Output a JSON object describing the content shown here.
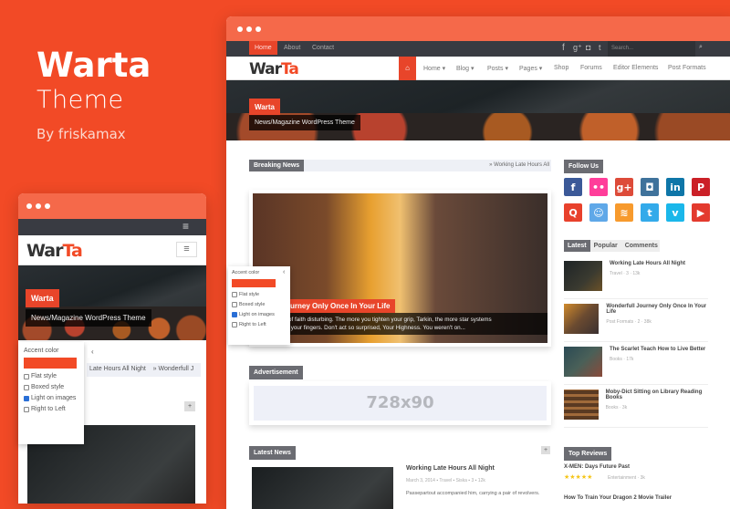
{
  "brand": {
    "title": "Warta",
    "subtitle": "Theme",
    "author": "By friskamax",
    "accent": "#f24a26"
  },
  "desktop": {
    "topbar": {
      "links": [
        "Home",
        "About",
        "Contact"
      ],
      "social_icons": [
        "facebook-icon",
        "google-plus-icon",
        "instagram-icon",
        "twitter-icon"
      ],
      "search_placeholder": "Search..."
    },
    "logo": {
      "part1": "War",
      "part2": "Ta"
    },
    "nav": [
      "Home ▾",
      "Blog ▾",
      "Posts ▾",
      "Pages ▾",
      "Shop",
      "Forums",
      "Editor Elements",
      "Post Formats"
    ],
    "hero": {
      "tag": "Warta",
      "tagline": "News/Magazine WordPress Theme"
    },
    "breaking": {
      "label": "Breaking News",
      "item": "» Working Late Hours All"
    },
    "featured": {
      "title": "derfull Journey Only Once In Your Life",
      "excerpt1": "your lack of faith disturbing. The more you tighten your grip, Tarkin, the more star systems",
      "excerpt2": "ip through your fingers. Don't act so surprised, Your Highness. You weren't on..."
    },
    "ad": {
      "label": "Advertisement",
      "size": "728x90"
    },
    "latest": {
      "label": "Latest News",
      "plus": "+",
      "title": "Working Late Hours All Night",
      "meta": "March 3, 2014  ▪ Travel  ▪ Siska  ▪ 3  ▪ 12k",
      "excerpt": "Passepartout accompanied him, carrying a pair of revolvers."
    },
    "sidebar": {
      "follow_label": "Follow Us",
      "social": [
        {
          "name": "facebook",
          "glyph": "f",
          "color": "#3b5998"
        },
        {
          "name": "flickr",
          "glyph": "••",
          "color": "#ff3d9a"
        },
        {
          "name": "google-plus",
          "glyph": "g+",
          "color": "#dd4b39"
        },
        {
          "name": "instagram",
          "glyph": "◘",
          "color": "#3f729b"
        },
        {
          "name": "linkedin",
          "glyph": "in",
          "color": "#0e76a8"
        },
        {
          "name": "pinterest",
          "glyph": "P",
          "color": "#cb2027"
        },
        {
          "name": "quora",
          "glyph": "Q",
          "color": "#e8412c"
        },
        {
          "name": "reddit",
          "glyph": "☺",
          "color": "#5fa8e8"
        },
        {
          "name": "rss",
          "glyph": "≋",
          "color": "#f79a2d"
        },
        {
          "name": "twitter",
          "glyph": "t",
          "color": "#33aaea"
        },
        {
          "name": "vimeo",
          "glyph": "v",
          "color": "#1ab7ea"
        },
        {
          "name": "youtube",
          "glyph": "▶",
          "color": "#e33a2e"
        }
      ],
      "tabs": [
        "Latest",
        "Popular",
        "Comments"
      ],
      "posts": [
        {
          "title": "Working Late Hours All Night",
          "meta": "Travel  · 3  · 13k",
          "thumb": "linear-gradient(135deg,#1e2426,#3a3a30 60%,#6b5128)"
        },
        {
          "title": "Wonderfull Journey Only Once In Your Life",
          "meta": "Post Formats  · 2  · 38k",
          "thumb": "linear-gradient(135deg,#d08a2c,#6a4a30 50%,#3a3030)"
        },
        {
          "title": "The Scarlet Teach How to Live Better",
          "meta": "Books  · 17k",
          "thumb": "linear-gradient(135deg,#2a4a55,#4a6058 50%,#8a4a3a)"
        },
        {
          "title": "Moby-Dict Sitting on Library Reading Books",
          "meta": "Books  · 3k",
          "thumb": "repeating-linear-gradient(0deg,#5a3a22 0 4px,#a06a3a 4px 7px)"
        }
      ],
      "reviews_label": "Top Reviews",
      "review1": {
        "title": "X-MEN: Days Future Past",
        "stars": "★★★★★",
        "meta": "Entertainment  · 3k"
      },
      "review2": {
        "title": "How To Train Your Dragon 2 Movie Trailer"
      }
    },
    "switcher": {
      "accent_label": "Accent color",
      "toggle": "‹",
      "options": [
        {
          "label": "Flat style",
          "checked": false
        },
        {
          "label": "Boxed style",
          "checked": false
        },
        {
          "label": "Light on images",
          "checked": true
        },
        {
          "label": "Right to Left",
          "checked": false
        }
      ]
    }
  },
  "mobile": {
    "hero": {
      "tag": "Warta",
      "tagline": "News/Magazine WordPress Theme"
    },
    "breaking": "Late Hours All Night    » Wonderfull J",
    "plus": "+",
    "switcher": {
      "accent_label": "Accent color",
      "toggle": "‹",
      "options": [
        {
          "label": "Flat style",
          "checked": false
        },
        {
          "label": "Boxed style",
          "checked": false
        },
        {
          "label": "Light on images",
          "checked": true
        },
        {
          "label": "Right to Left",
          "checked": false
        }
      ]
    }
  }
}
